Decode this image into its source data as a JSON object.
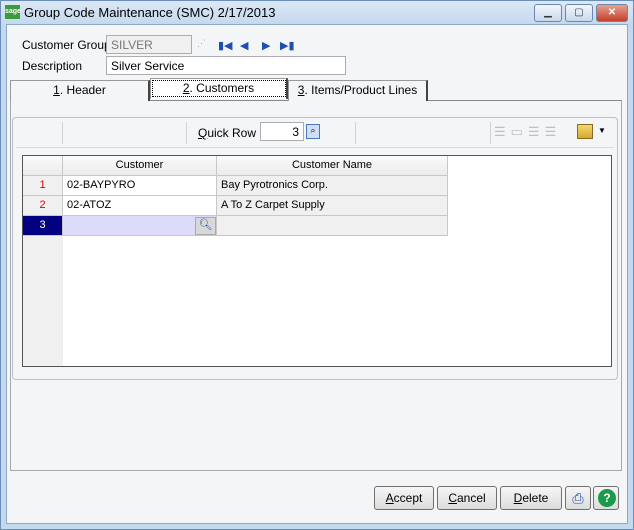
{
  "window": {
    "title": "Group Code Maintenance (SMC) 2/17/2013",
    "logo": "sage",
    "controls": [
      "minimize-icon",
      "maximize-icon",
      "close-icon"
    ]
  },
  "form": {
    "customer_group_label": "Customer Group",
    "customer_group_value": "SILVER",
    "description_label": "Description",
    "description_value": "Silver Service"
  },
  "tabs": [
    {
      "key": "1",
      "label": ". Header"
    },
    {
      "key": "2",
      "label": ". Customers"
    },
    {
      "key": "3",
      "label": ". Items/Product Lines"
    }
  ],
  "toolbar": {
    "quick_row_key": "Q",
    "quick_row_label": "uick Row",
    "quick_row_value": "3"
  },
  "grid": {
    "columns": [
      "Customer",
      "Customer Name"
    ],
    "rows": [
      {
        "num": "1",
        "customer": "02-BAYPYRO",
        "name": "Bay Pyrotronics Corp."
      },
      {
        "num": "2",
        "customer": "02-ATOZ",
        "name": "A To Z Carpet Supply"
      },
      {
        "num": "3",
        "customer": "",
        "name": ""
      }
    ]
  },
  "buttons": {
    "accept_key": "A",
    "accept": "ccept",
    "cancel_key": "C",
    "cancel": "ancel",
    "delete_key": "D",
    "delete": "elete"
  },
  "colors": {
    "selected_row": "#000080",
    "active_cell": "#dcdcfa",
    "row_number": "#dd0000"
  }
}
